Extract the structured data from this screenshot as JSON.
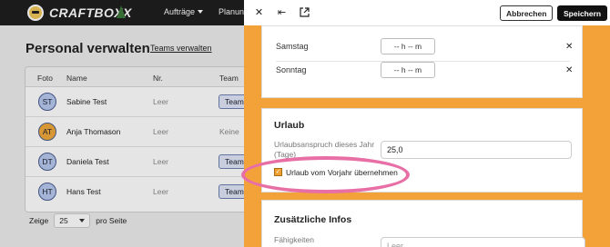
{
  "brand": {
    "name": "CRAFTBOXX"
  },
  "nav": {
    "items": [
      "Aufträge",
      "Planung"
    ]
  },
  "page": {
    "title": "Personal verwalten",
    "teams_link": "Teams verwalten"
  },
  "table": {
    "headers": [
      "Foto",
      "Name",
      "Nr.",
      "Team"
    ],
    "rows": [
      {
        "initials": "ST",
        "name": "Sabine Test",
        "nr": "Leer",
        "team": "Team",
        "avatar_color": "#b7c9ef"
      },
      {
        "initials": "AT",
        "name": "Anja Thomason",
        "nr": "Leer",
        "team": "Keine",
        "avatar_color": "#f0a93a"
      },
      {
        "initials": "DT",
        "name": "Daniela Test",
        "nr": "Leer",
        "team": "Team",
        "avatar_color": "#b7c9ef"
      },
      {
        "initials": "HT",
        "name": "Hans Test",
        "nr": "Leer",
        "team": "Team",
        "avatar_color": "#b7c9ef"
      }
    ]
  },
  "pager": {
    "prefix": "Zeige",
    "value": "25",
    "suffix": "pro Seite"
  },
  "drawer": {
    "cancel_label": "Abbrechen",
    "save_label": "Speichern",
    "days": [
      {
        "label": "Samstag",
        "time": "-- h  -- m"
      },
      {
        "label": "Sonntag",
        "time": "-- h  -- m"
      }
    ],
    "vacation": {
      "title": "Urlaub",
      "entitlement_label": "Urlaubsanspruch dieses Jahr (Tage)",
      "entitlement_value": "25,0",
      "carryover_label": "Urlaub vom Vorjahr übernehmen",
      "carryover_checked": true
    },
    "extra": {
      "title": "Zusätzliche Infos",
      "skills_label": "Fähigkeiten",
      "skills_placeholder": "Leer"
    }
  },
  "colors": {
    "accent": "#f3a23a",
    "highlight": "#e86fa6"
  }
}
